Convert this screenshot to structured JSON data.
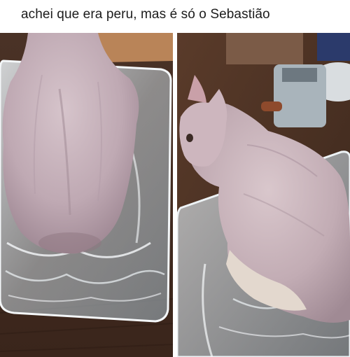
{
  "post": {
    "caption": "achei que era peru, mas é só o Sebastião"
  },
  "photos": [
    {
      "subject": "hairless-sphynx-cat-in-plastic-tray-from-behind"
    },
    {
      "subject": "hairless-sphynx-cat-in-plastic-tray-side-view"
    }
  ]
}
